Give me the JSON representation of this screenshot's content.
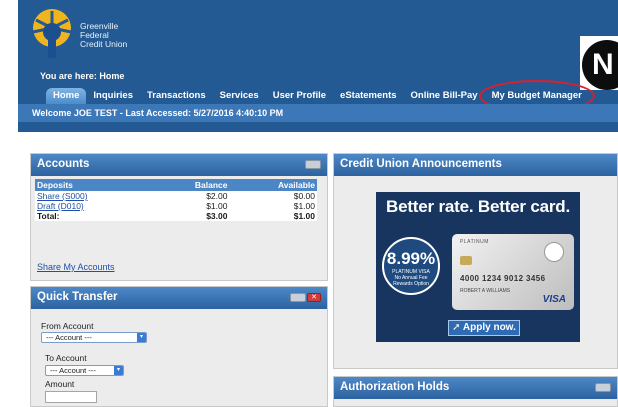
{
  "brand": {
    "line1": "Greenville",
    "line2": "Federal",
    "line3": "Credit Union",
    "colors": {
      "header": "#245a93",
      "logo_gold": "#f0b51e",
      "logo_blue": "#1b4f8f"
    }
  },
  "breadcrumb": "You are here: Home",
  "corner_letter": "N",
  "nav": {
    "tabs": [
      {
        "label": "Home",
        "active": true
      },
      {
        "label": "Inquiries"
      },
      {
        "label": "Transactions"
      },
      {
        "label": "Services"
      },
      {
        "label": "User Profile"
      },
      {
        "label": "eStatements"
      },
      {
        "label": "Online Bill-Pay"
      },
      {
        "label": "My Budget Manager",
        "highlighted": true
      }
    ]
  },
  "welcome": "Welcome JOE TEST - Last Accessed: 5/27/2016 4:40:10 PM",
  "accounts": {
    "title": "Accounts",
    "headers": {
      "name": "Deposits",
      "balance": "Balance",
      "available": "Available"
    },
    "rows": [
      {
        "name": "Share (S000)",
        "balance": "$2.00",
        "available": "$0.00"
      },
      {
        "name": "Draft (D010)",
        "balance": "$1.00",
        "available": "$1.00"
      }
    ],
    "total": {
      "label": "Total:",
      "balance": "$3.00",
      "available": "$1.00"
    },
    "share_link": "Share My Accounts"
  },
  "quick_transfer": {
    "title": "Quick Transfer",
    "from_label": "From Account",
    "from_value": "--- Account ---",
    "to_label": "To Account",
    "to_value": "--- Account ---",
    "amount_label": "Amount"
  },
  "announcements": {
    "title": "Credit Union Announcements",
    "promo_title": "Better rate. Better card.",
    "rate": "8.99%",
    "rate_sub1": "PLATINUM VISA",
    "rate_sub2": "No Annual Fee",
    "rate_sub3": "Rewards Option",
    "card_tier": "PLATINUM",
    "card_number": "4000 1234 9012 3456",
    "card_name": "ROBERT A WILLIAMS",
    "card_brand": "VISA",
    "apply_label": "Apply now."
  },
  "authorization": {
    "title": "Authorization Holds"
  }
}
